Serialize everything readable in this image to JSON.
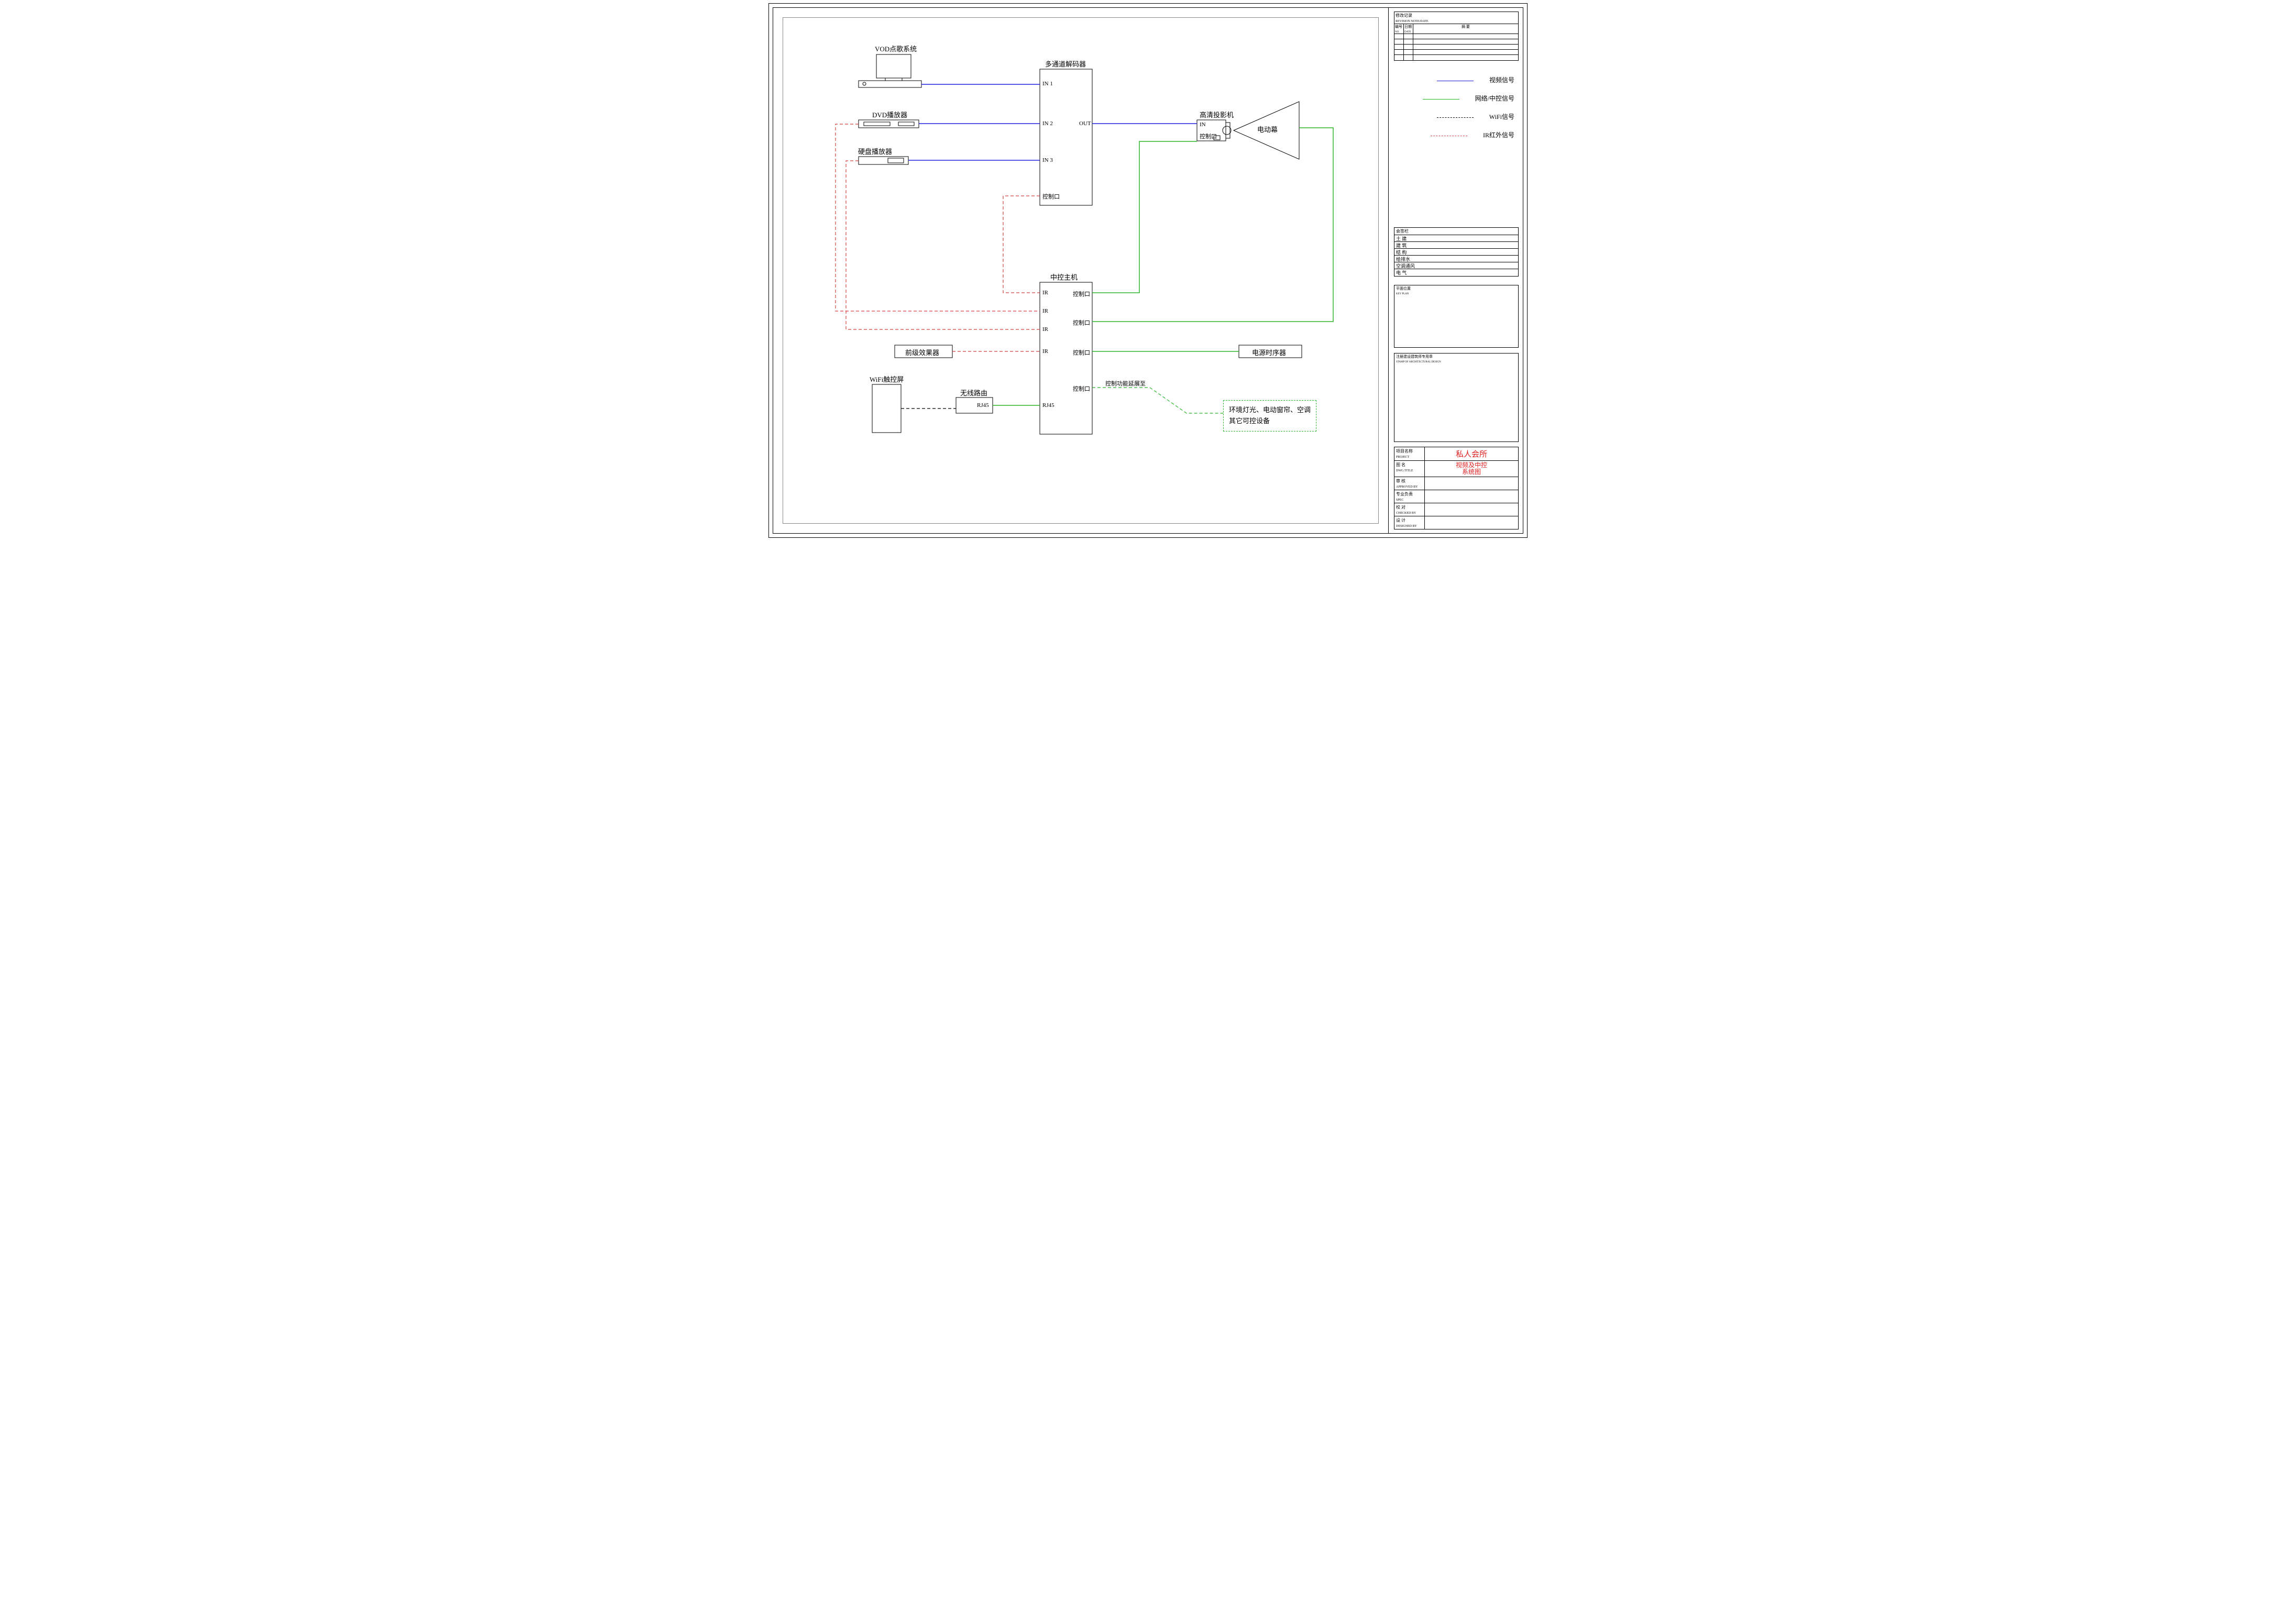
{
  "sources": {
    "vod": "VOD点歌系统",
    "dvd": "DVD播放器",
    "hdd": "硬盘播放器"
  },
  "decoder": {
    "title": "多通道解码器",
    "in1": "IN 1",
    "in2": "IN 2",
    "in3": "IN 3",
    "out": "OUT",
    "ctrl": "控制口"
  },
  "projector": {
    "title": "高清投影机",
    "in": "IN",
    "ctrl": "控制口"
  },
  "screen": "电动幕",
  "controller": {
    "title": "中控主机",
    "ir": "IR",
    "ctrl": "控制口",
    "rj45": "RJ45"
  },
  "preamp": "前级效果器",
  "wifi_panel": "WiFi触控屏",
  "router": {
    "title": "无线路由",
    "port": "RJ45"
  },
  "sequencer": "电源时序器",
  "extension": {
    "note": "控制功能延展至",
    "line1": "环境灯光、电动窗帘、空调",
    "line2": "其它可控设备"
  },
  "legend": {
    "video": "视频信号",
    "net": "网络/中控信号",
    "wifi": "WiFi信号",
    "ir": "IR红外信号"
  },
  "titleblock": {
    "revision_hdr": "修改记录",
    "revision_sub": "REVISION NOTE/DATE",
    "col_no": "编号",
    "col_no_en": "NO.",
    "col_date": "日期",
    "col_date_en": "DATE",
    "col_desc": "摘    要",
    "sig_hdr": "会签栏",
    "sig_rows": [
      "土  建",
      "建  筑",
      "结  构",
      "给排水",
      "空调通风",
      "电  气"
    ],
    "keyplan": "平面位置",
    "keyplan_en": "KEY PLAN",
    "stamp": "注册建设建筑师专用章",
    "stamp_en": "STAMP OF ARCHITECTURAL DESIGN",
    "project_lbl": "项目名称",
    "project_en": "PROJECT",
    "project_val": "私人会所",
    "dwg_lbl": "图  名",
    "dwg_en": "DWG.TITLE",
    "dwg_line1": "视频及中控",
    "dwg_line2": "系统图",
    "approve_lbl": "审  核",
    "approve_en": "APPROVED BY",
    "spec_lbl": "专业负责",
    "spec_en": "SPEC",
    "check_lbl": "校  对",
    "check_en": "CHECKED BY",
    "design_lbl": "设  计",
    "design_en": "DESIGNED BY"
  }
}
